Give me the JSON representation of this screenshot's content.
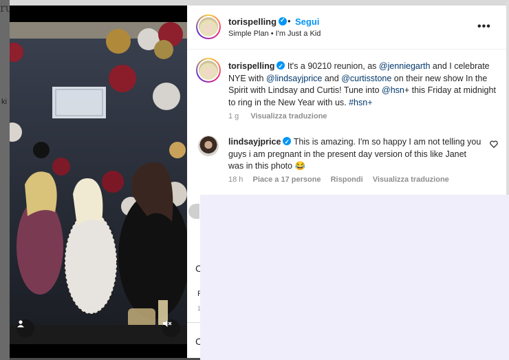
{
  "background": {
    "glyph_top_left": "ru",
    "glyph_mid_left": "ki"
  },
  "post": {
    "header": {
      "username": "torispelling",
      "dot": "•",
      "follow_label": "Segui",
      "audio": "Simple Plan • I'm Just a Kid",
      "more_icon": "more-horizontal-icon"
    },
    "caption": {
      "username": "torispelling",
      "part1": "It's a 90210 reunion, as ",
      "mention1": "@jenniegarth",
      "part2": " and I celebrate NYE with ",
      "mention2": "@lindsayjprice",
      "part3": " and ",
      "mention3": "@curtisstone",
      "part4": " on their new show In the Spirit with Lindsay and Curtis! Tune into ",
      "mention4": "@hsn",
      "part5": "+ this Friday at midnight to ring in the New Year with us. ",
      "hashtag": "#hsn+",
      "time": "1 g",
      "translate": "Visualizza traduzione"
    },
    "comment": {
      "username": "lindsayjprice",
      "text": "This is amazing. I'm so happy I am not telling you guys i am pregnant in the present day version of this like Janet was in this photo",
      "emoji": "😂",
      "time": "18 h",
      "likes": "Piace a 17 persone",
      "reply": "Rispondi",
      "translate": "Visualizza traduzione"
    },
    "partial_glyphs": [
      "C",
      "F",
      "1"
    ],
    "icons": {
      "verified": "verified-badge-icon",
      "heart": "heart-icon",
      "user_tag": "user-tag-icon",
      "mute": "sound-off-icon"
    },
    "colors": {
      "link_blue": "#0095f6",
      "mention": "#00376b",
      "secondary_text": "#8e8e8e",
      "overlay": "#efeefa"
    }
  }
}
